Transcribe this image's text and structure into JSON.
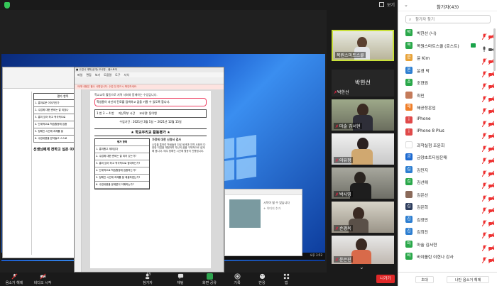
{
  "top_bar": {
    "view_label": "보기"
  },
  "pdf": {
    "title": "■ 수업나 계획(공개) 교사명 - 쌤스토어",
    "menu": [
      "파일",
      "편집",
      "보기",
      "도움말",
      "도구",
      "서식"
    ],
    "alert": "아래 내용은 필수 사항입니다. 수업 전 반드시 확인하세요.",
    "text_intro": "학교교육 활동으로 지역 사회와 함께하는 수업입니다.",
    "box_text": "학생들이 자신의 진로를 탐색하고 꿈을 키울 수 있도록 합니다.",
    "info_fields": [
      "1 반 3 ~ 4 반",
      "지산학부 시간",
      "교사명: 동이엔"
    ],
    "period": "수업기간 : 2021년 3월 1일 ~ 2021년 12월 15일",
    "heading": "★ 학교우리교 활동평가 ★",
    "eval_header": "평가 항목",
    "eval_rows": [
      "1. 흥미롭고 재미있다",
      "2. 수업에 대한 준비는 잘 되어 있는가?",
      "3. 흥미 있어 하고 적극적으로 참여하는가?",
      "4. 단계적으로 학습활동에 집중하는가?",
      "5. 정해진 시간에 과제를 잘 제출하였는가?",
      "6. 수업내용을 문제없이 이해하는가?"
    ],
    "right_title": "가정에 대한 신청서 검사",
    "right_text": "수업을 통하여 학생들의 진로 탐색과 지역 사회의 다양한 직업을 체험하며 자신의 꿈을 구체적으로 설계해 봅니다. 매주 정해진 시간에 활동이 진행됩니다."
  },
  "left_doc": {
    "caption": "평가 항목",
    "rows": [
      "1. 흥미로운 이야기인가",
      "2. 수업에 대한 준비는 잘 되었나",
      "3. 흥미 있어 하고 적극적으로",
      "4. 단계적으로 학습활동에 집중",
      "5. 정해진 시간에 과제를 잘",
      "6. 수업내용을 받아들고 스스로"
    ],
    "bottom_text": "선생님에게 전하고 싶은 이야기"
  },
  "popup": {
    "title": "시작이 될 수 있습니다",
    "sub": "+ 이미지 추가"
  },
  "taskbar": {
    "time": "오후 3:52"
  },
  "tiles": [
    {
      "name": "목원스마트스쿨",
      "muted": false
    },
    {
      "name": "박한선",
      "muted": true
    },
    {
      "name": "마술 김서현",
      "muted": true
    },
    {
      "name": "이유정",
      "muted": true
    },
    {
      "name": "박시영",
      "muted": true
    },
    {
      "name": "손경옥",
      "muted": true
    },
    {
      "name": "윤은진",
      "muted": true
    }
  ],
  "namecard": {
    "big": "박한선",
    "small": "박한선"
  },
  "toolbar": {
    "audio": "음소거 해제",
    "video": "비디오 시작",
    "participants": "참가자",
    "participants_count": "43",
    "chat": "채팅",
    "share": "화면 공유",
    "record": "기록",
    "reactions": "반응",
    "apps": "앱",
    "leave": "나가기"
  },
  "panel": {
    "title": "참가자(43)",
    "search_placeholder": "참가자 찾기",
    "participants": [
      {
        "name": "박한선 (나)",
        "color": "#2aa84a",
        "initial": "박",
        "mic": "muted",
        "cam": "off",
        "host": false
      },
      {
        "name": "목원스마트스쿨 (호스트)",
        "color": "#2aa84a",
        "initial": "목",
        "mic": "on",
        "cam": "on",
        "host": true
      },
      {
        "name": "윤 Kim",
        "color": "#e8a33a",
        "initial": "윤",
        "mic": "muted",
        "cam": "off",
        "host": false
      },
      {
        "name": "윤경 박",
        "color": "#2e7fd1",
        "initial": "윤",
        "mic": "muted",
        "cam": "off",
        "host": false
      },
      {
        "name": "조현원",
        "color": "#2aa84a",
        "initial": "조",
        "mic": "muted",
        "cam": "off",
        "host": false
      },
      {
        "name": "최민",
        "color": "#c47b5a",
        "initial": "",
        "mic": "muted",
        "cam": "off",
        "host": false
      },
      {
        "name": "해공정온입",
        "color": "#f07f2a",
        "initial": "해",
        "mic": "muted",
        "cam": "off",
        "host": false
      },
      {
        "name": "iPhone",
        "color": "#e04a4a",
        "initial": "i",
        "mic": "muted",
        "cam": "off",
        "host": false
      },
      {
        "name": "iPhone 8 Plus",
        "color": "#e04a4a",
        "initial": "i",
        "mic": "muted",
        "cam": "off",
        "host": false
      },
      {
        "name": "과학실험 조윤희",
        "color": "#ffffff",
        "initial": "",
        "mic": "muted",
        "cam": "off",
        "host": false
      },
      {
        "name": "금양초트티임은매",
        "color": "#1d6ad1",
        "initial": "금",
        "mic": "muted",
        "cam": "off",
        "host": false
      },
      {
        "name": "김민지",
        "color": "#2e7fd1",
        "initial": "김",
        "mic": "muted",
        "cam": "off",
        "host": false
      },
      {
        "name": "김선애",
        "color": "#2aa84a",
        "initial": "김",
        "mic": "muted",
        "cam": "off",
        "host": false
      },
      {
        "name": "김은선",
        "color": "#8a6a5a",
        "initial": "",
        "mic": "muted",
        "cam": "off",
        "host": false
      },
      {
        "name": "김은희",
        "color": "#2e3e5e",
        "initial": "김",
        "mic": "muted",
        "cam": "off",
        "host": false
      },
      {
        "name": "김정민",
        "color": "#2e7fd1",
        "initial": "김",
        "mic": "muted",
        "cam": "off",
        "host": false
      },
      {
        "name": "김희진",
        "color": "#2e7fd1",
        "initial": "김",
        "mic": "muted",
        "cam": "off",
        "host": false
      },
      {
        "name": "마술 김서현",
        "color": "#2aa84a",
        "initial": "마",
        "mic": "muted",
        "cam": "off",
        "host": false
      },
      {
        "name": "바이올린 이현나 강사",
        "color": "#2aa84a",
        "initial": "바",
        "mic": "muted",
        "cam": "off",
        "host": false
      }
    ],
    "invite": "초대",
    "unmute_me": "나만 음소거 해제"
  }
}
